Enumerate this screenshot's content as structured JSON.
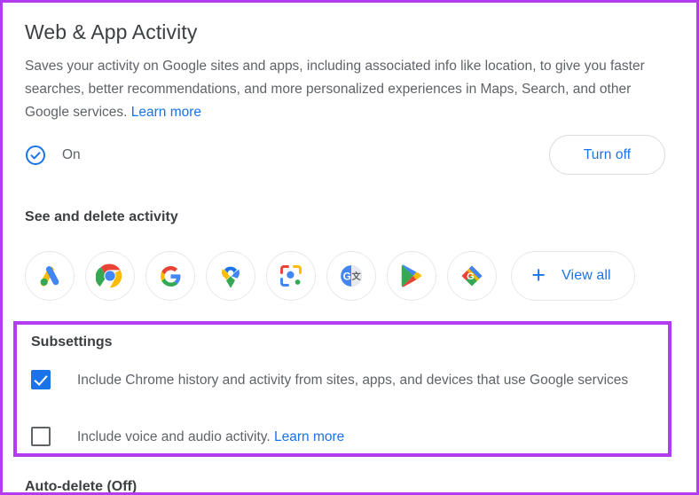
{
  "header": {
    "title": "Web & App Activity",
    "description_part1": "Saves your activity on Google sites and apps, including associated info like location, to give you faster searches, better recommendations, and more personalized experiences in Maps, Search, and other Google services. ",
    "learn_more": "Learn more"
  },
  "status": {
    "icon": "check-circle-icon",
    "label": "On",
    "turn_off_label": "Turn off"
  },
  "activity": {
    "section_title": "See and delete activity",
    "apps": [
      {
        "name": "google-ads",
        "label": "Google Ads"
      },
      {
        "name": "chrome",
        "label": "Chrome"
      },
      {
        "name": "google-search",
        "label": "Google Search"
      },
      {
        "name": "google-maps",
        "label": "Google Maps"
      },
      {
        "name": "google-lens",
        "label": "Google Lens"
      },
      {
        "name": "google-translate",
        "label": "Google Translate"
      },
      {
        "name": "google-play",
        "label": "Google Play"
      },
      {
        "name": "google-shopping",
        "label": "Google Shopping"
      }
    ],
    "view_all_label": "View all",
    "plus_glyph": "+"
  },
  "subsettings": {
    "title": "Subsettings",
    "items": [
      {
        "checked": true,
        "label": "Include Chrome history and activity from sites, apps, and devices that use Google services",
        "learn_more": ""
      },
      {
        "checked": false,
        "label": "Include voice and audio activity. ",
        "learn_more": "Learn more"
      }
    ]
  },
  "footer": {
    "auto_delete": "Auto-delete (Off)"
  },
  "colors": {
    "accent_blue": "#1a73e8",
    "highlight_purple": "#b43cf0",
    "text_primary": "#3c4043",
    "text_secondary": "#5f6368",
    "border": "#dadce0"
  }
}
